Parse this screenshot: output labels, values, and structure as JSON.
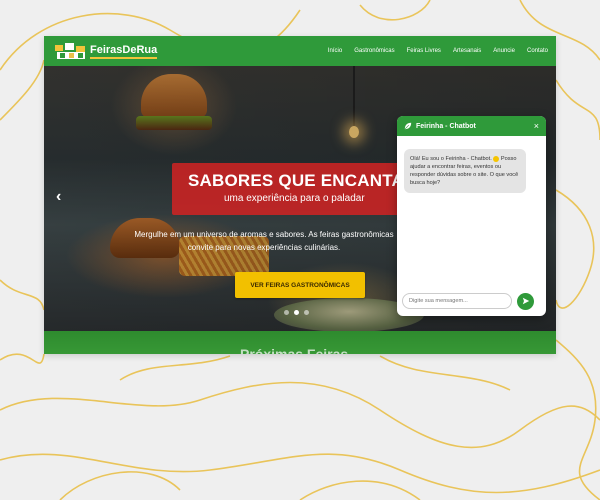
{
  "brand": {
    "name": "FeirasDeRua"
  },
  "nav": {
    "items": [
      {
        "label": "Início"
      },
      {
        "label": "Gastronômicas"
      },
      {
        "label": "Feiras Livres"
      },
      {
        "label": "Artesanais"
      },
      {
        "label": "Anuncie"
      },
      {
        "label": "Contato"
      }
    ]
  },
  "hero": {
    "title": "SABORES QUE ENCANTA",
    "subtitle": "uma experiência para o paladar",
    "body_line1": "Mergulhe em um universo de aromas e sabores. As feiras gastronômicas",
    "body_line2": "convite para novas experiências culinárias.",
    "cta_label": "VER FEIRAS GASTRONÔMICAS",
    "prev_label": "‹",
    "slide_count": 3,
    "active_slide": 2
  },
  "section_peek": {
    "text": "Próximas Feiras"
  },
  "chatbot": {
    "title": "Feirinha - Chatbot",
    "close_label": "×",
    "message_line1": "Olá! Eu sou o Feirinha - Chatbot.",
    "message_rest": "Posso ajudar a encontrar feiras, eventos ou responder dúvidas sobre o site. O que você busca hoje?",
    "input_placeholder": "Digite sua mensagem..."
  },
  "colors": {
    "nav_green": "#2f9a3a",
    "title_red": "#cd2323",
    "cta_yellow": "#f2c000",
    "swirl_gold": "#e9c04a"
  }
}
